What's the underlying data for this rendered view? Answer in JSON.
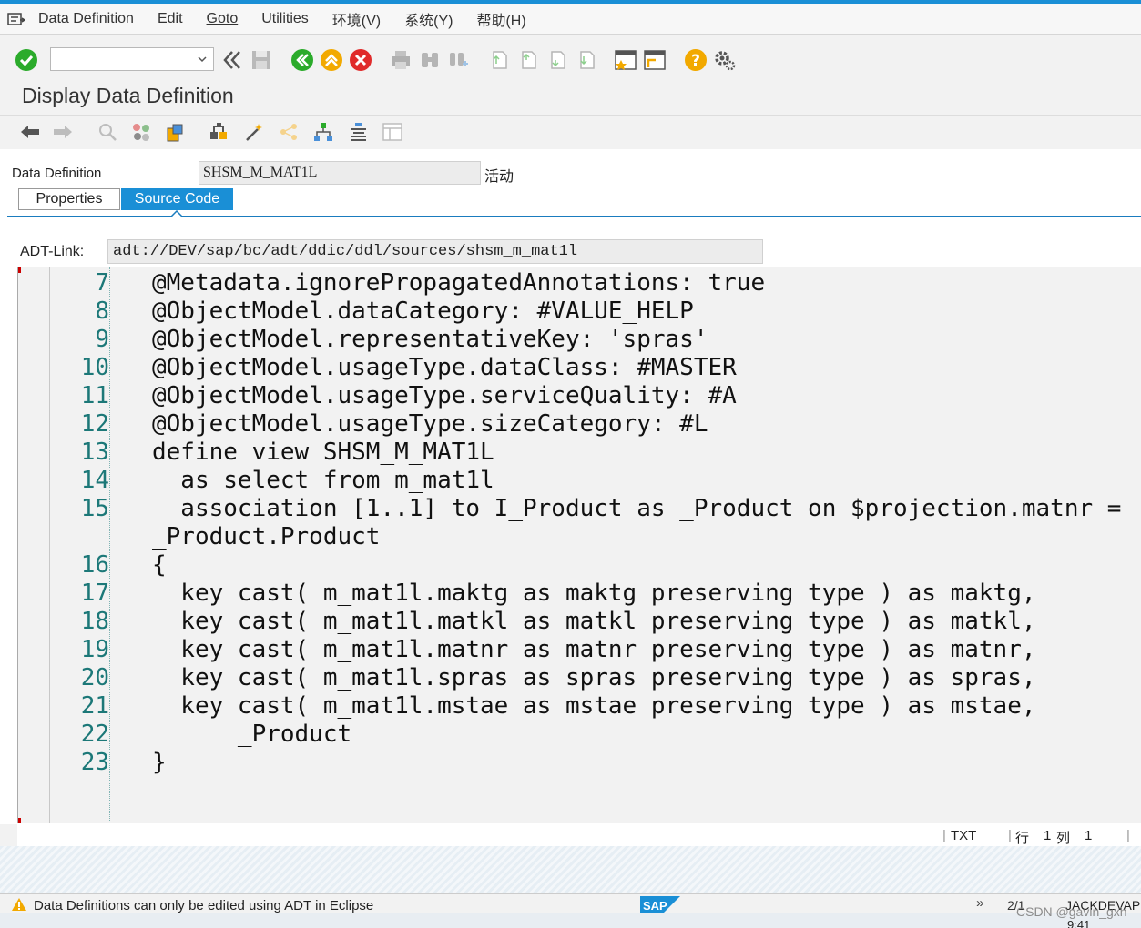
{
  "menubar": {
    "items": [
      {
        "label": "Data Definition"
      },
      {
        "label": "Edit"
      },
      {
        "label": "Goto"
      },
      {
        "label": "Utilities"
      },
      {
        "label": "环境(V)"
      },
      {
        "label": "系统(Y)"
      },
      {
        "label": "帮助(H)"
      }
    ]
  },
  "command_field": {
    "value": ""
  },
  "page": {
    "title": "Display Data Definition"
  },
  "header": {
    "label": "Data Definition",
    "name": "SHSM_M_MAT1L",
    "status": "活动"
  },
  "tabs": [
    {
      "label": "Properties"
    },
    {
      "label": "Source Code"
    }
  ],
  "adt": {
    "label": "ADT-Link:",
    "value": "adt://DEV/sap/bc/adt/ddic/ddl/sources/shsm_m_mat1l"
  },
  "code_lines": [
    {
      "num": "7",
      "text": "@Metadata.ignorePropagatedAnnotations: true"
    },
    {
      "num": "8",
      "text": "@ObjectModel.dataCategory: #VALUE_HELP"
    },
    {
      "num": "9",
      "text": "@ObjectModel.representativeKey: 'spras'"
    },
    {
      "num": "10",
      "text": "@ObjectModel.usageType.dataClass: #MASTER"
    },
    {
      "num": "11",
      "text": "@ObjectModel.usageType.serviceQuality: #A"
    },
    {
      "num": "12",
      "text": "@ObjectModel.usageType.sizeCategory: #L"
    },
    {
      "num": "13",
      "text": "define view SHSM_M_MAT1L"
    },
    {
      "num": "14",
      "text": "  as select from m_mat1l"
    },
    {
      "num": "15",
      "text": "  association [1..1] to I_Product as _Product on $projection.matnr ="
    },
    {
      "num": "",
      "text": "_Product.Product"
    },
    {
      "num": "16",
      "text": "{"
    },
    {
      "num": "17",
      "text": "  key cast( m_mat1l.maktg as maktg preserving type ) as maktg,"
    },
    {
      "num": "18",
      "text": "  key cast( m_mat1l.matkl as matkl preserving type ) as matkl,"
    },
    {
      "num": "19",
      "text": "  key cast( m_mat1l.matnr as matnr preserving type ) as matnr,"
    },
    {
      "num": "20",
      "text": "  key cast( m_mat1l.spras as spras preserving type ) as spras,"
    },
    {
      "num": "21",
      "text": "  key cast( m_mat1l.mstae as mstae preserving type ) as mstae,"
    },
    {
      "num": "22",
      "text": "      _Product"
    },
    {
      "num": "23",
      "text": "}"
    }
  ],
  "editor_status": {
    "mode": "TXT",
    "line_label": "行",
    "line_value": "1",
    "col_label": "列",
    "col_value": "1"
  },
  "statusbar": {
    "message": "Data Definitions can only be edited using ADT in Eclipse",
    "logo_text": "SAP",
    "nav": "»",
    "session": "2/1",
    "user": "JACKDEVAP",
    "watermark": "CSDN @gavin_gxh",
    "time": "9:41"
  },
  "colors": {
    "accent": "#1a8fd6",
    "line_number": "#1c7878",
    "ok_green": "#2bab2b",
    "cancel_red": "#e02b2b",
    "nav_yellow": "#f2a900"
  }
}
